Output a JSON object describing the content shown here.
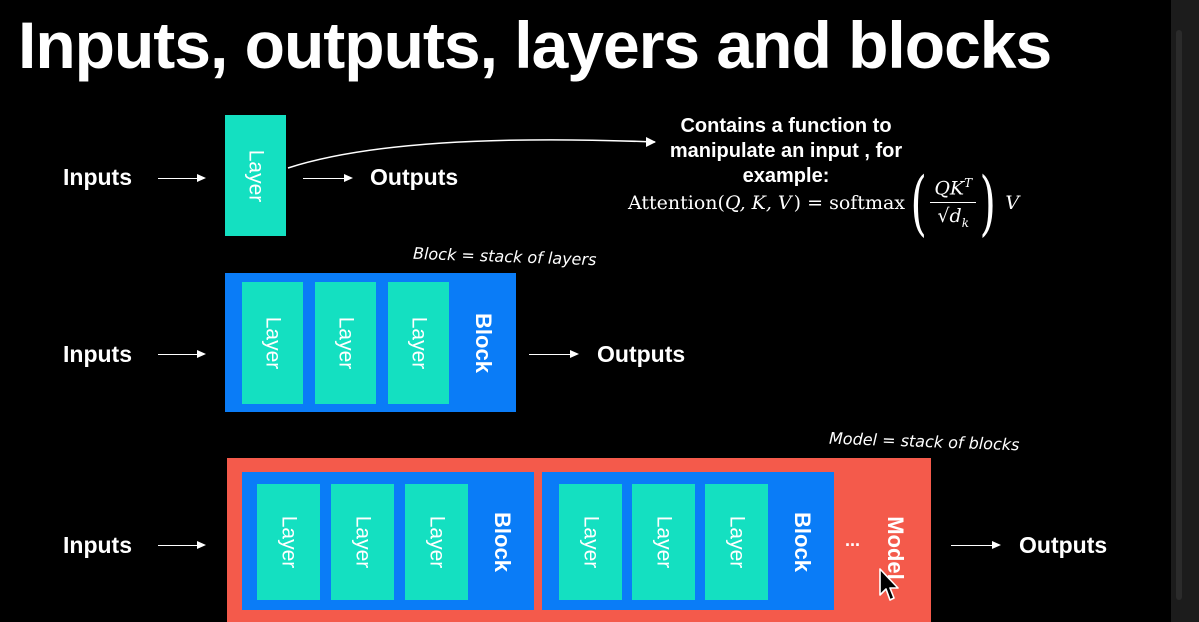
{
  "title": "Inputs, outputs, layers and blocks",
  "inputs_label": "Inputs",
  "outputs_label": "Outputs",
  "layer_label": "Layer",
  "block_label": "Block",
  "model_label": "Model",
  "ellipsis": "...",
  "function_caption": [
    "Contains a function to",
    "manipulate an input , for",
    "example:"
  ],
  "formula": {
    "lhs": "Attention(",
    "args": "Q, K, V",
    "eq": ") = softmax",
    "numerator": "QK",
    "numerator_sup": "T",
    "denominator": "√d",
    "denominator_sub": "k",
    "tail": "V"
  },
  "block_annotation": "Block = stack of layers",
  "model_annotation": "Model = stack of blocks",
  "colors": {
    "layer": "#14e0c1",
    "block": "#0a7cf7",
    "model": "#f45a4b",
    "background": "#000000"
  },
  "icons": [
    "right-arrow-icon",
    "curved-arrow-icon",
    "mouse-pointer-icon"
  ]
}
